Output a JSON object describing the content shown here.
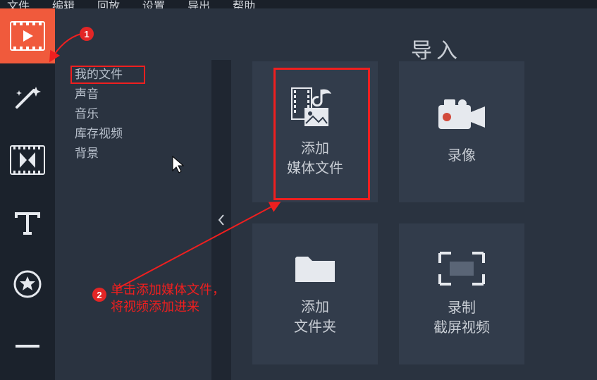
{
  "menu": {
    "items": [
      "文件",
      "编辑",
      "回放",
      "设置",
      "导出",
      "帮助"
    ]
  },
  "sidebar": {
    "items": [
      "我的文件",
      "声音",
      "音乐",
      "库存视频",
      "背景"
    ]
  },
  "main": {
    "title": "导入",
    "tiles": [
      {
        "label1": "添加",
        "label2": "媒体文件"
      },
      {
        "label1": "录像",
        "label2": ""
      },
      {
        "label1": "添加",
        "label2": "文件夹"
      },
      {
        "label1": "录制",
        "label2": "截屏视频"
      }
    ]
  },
  "annotations": {
    "badge1": "1",
    "badge2": "2",
    "text_line1": "单击添加媒体文件，",
    "text_line2": "将视频添加进来"
  }
}
